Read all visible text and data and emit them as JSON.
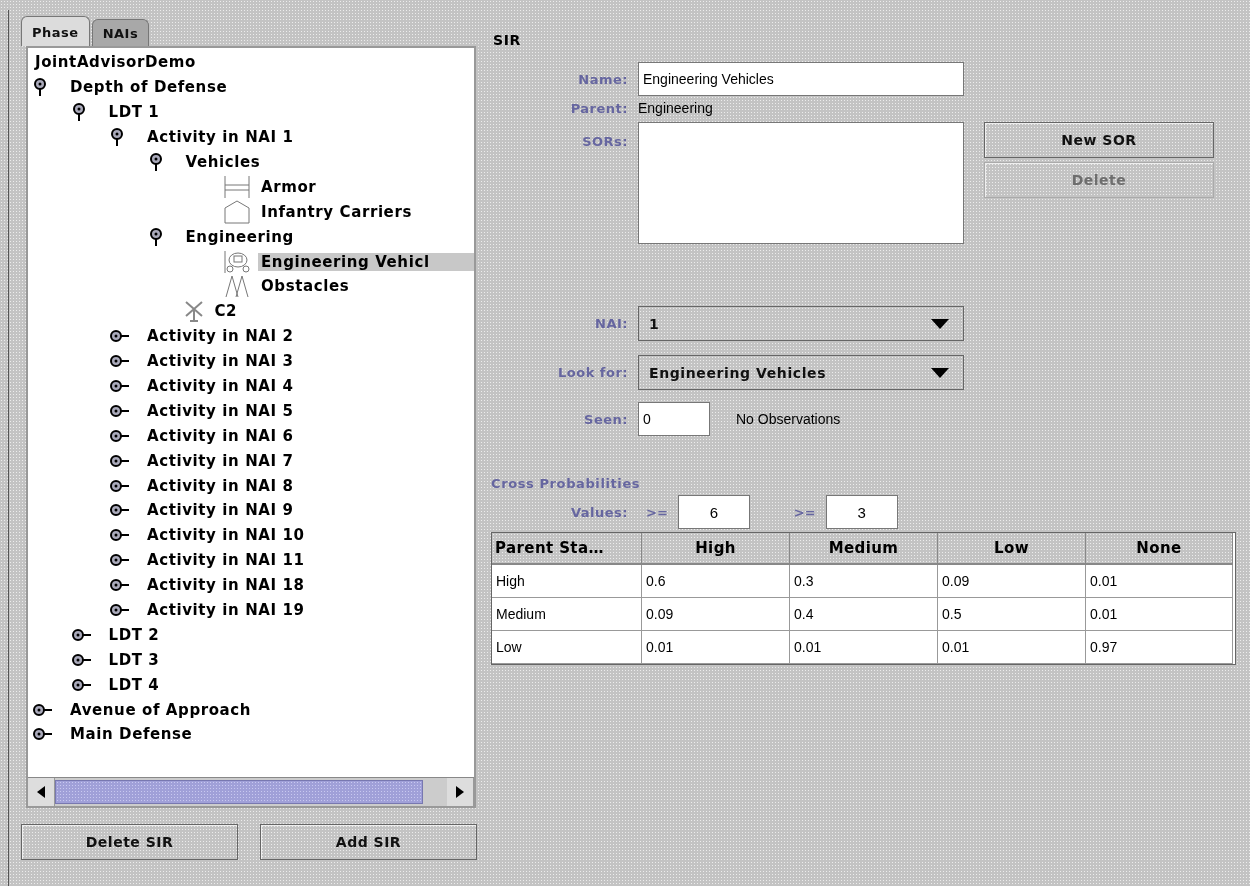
{
  "tabs": [
    {
      "label": "Phase",
      "selected": true
    },
    {
      "label": "NAIs",
      "selected": false
    }
  ],
  "tree": {
    "label": "JointAdvisorDemo",
    "kind": "root",
    "selected": false,
    "children": [
      {
        "label": "Depth of Defense",
        "kind": "group",
        "expanded": true,
        "selected": false,
        "children": [
          {
            "label": "LDT 1",
            "kind": "group",
            "expanded": true,
            "selected": false,
            "children": [
              {
                "label": "Activity in NAI 1",
                "kind": "group",
                "expanded": true,
                "selected": false,
                "children": [
                  {
                    "label": "Vehicles",
                    "kind": "group",
                    "expanded": true,
                    "selected": false,
                    "children": [
                      {
                        "label": "Armor",
                        "kind": "armor",
                        "selected": false
                      },
                      {
                        "label": "Infantry Carriers",
                        "kind": "infantry",
                        "selected": false
                      }
                    ]
                  },
                  {
                    "label": "Engineering",
                    "kind": "group",
                    "expanded": true,
                    "selected": false,
                    "children": [
                      {
                        "label": "Engineering Vehicl",
                        "kind": "engineer",
                        "selected": true
                      },
                      {
                        "label": "Obstacles",
                        "kind": "obstacle",
                        "selected": false
                      }
                    ]
                  },
                  {
                    "label": "C2",
                    "kind": "c2",
                    "selected": false
                  }
                ]
              },
              {
                "label": "Activity in NAI 2",
                "kind": "group",
                "expanded": false,
                "selected": false
              },
              {
                "label": "Activity in NAI 3",
                "kind": "group",
                "expanded": false,
                "selected": false
              },
              {
                "label": "Activity in NAI 4",
                "kind": "group",
                "expanded": false,
                "selected": false
              },
              {
                "label": "Activity in NAI 5",
                "kind": "group",
                "expanded": false,
                "selected": false
              },
              {
                "label": "Activity in NAI 6",
                "kind": "group",
                "expanded": false,
                "selected": false
              },
              {
                "label": "Activity in NAI 7",
                "kind": "group",
                "expanded": false,
                "selected": false
              },
              {
                "label": "Activity in NAI 8",
                "kind": "group",
                "expanded": false,
                "selected": false
              },
              {
                "label": "Activity in NAI 9",
                "kind": "group",
                "expanded": false,
                "selected": false
              },
              {
                "label": "Activity in NAI 10",
                "kind": "group",
                "expanded": false,
                "selected": false
              },
              {
                "label": "Activity in NAI 11",
                "kind": "group",
                "expanded": false,
                "selected": false
              },
              {
                "label": "Activity in NAI 18",
                "kind": "group",
                "expanded": false,
                "selected": false
              },
              {
                "label": "Activity in NAI 19",
                "kind": "group",
                "expanded": false,
                "selected": false
              }
            ]
          },
          {
            "label": "LDT 2",
            "kind": "group",
            "expanded": false,
            "selected": false
          },
          {
            "label": "LDT 3",
            "kind": "group",
            "expanded": false,
            "selected": false
          },
          {
            "label": "LDT 4",
            "kind": "group",
            "expanded": false,
            "selected": false
          }
        ]
      },
      {
        "label": "Avenue of Approach",
        "kind": "group",
        "expanded": false,
        "selected": false
      },
      {
        "label": "Main Defense",
        "kind": "group",
        "expanded": false,
        "selected": false
      }
    ]
  },
  "left_buttons": [
    {
      "label": "Delete SIR"
    },
    {
      "label": "Add SIR"
    }
  ],
  "sir": {
    "title": "SIR",
    "name": {
      "label": "Name:",
      "value": "Engineering Vehicles"
    },
    "parent": {
      "label": "Parent:",
      "value": "Engineering"
    },
    "sors": {
      "label": "SORs:"
    },
    "sor_buttons": [
      {
        "label": "New SOR",
        "disabled": false
      },
      {
        "label": "Delete",
        "disabled": true
      }
    ],
    "nai": {
      "label": "NAI:",
      "value": "1"
    },
    "look_for": {
      "label": "Look for:",
      "value": "Engineering Vehicles"
    },
    "seen": {
      "label": "Seen:",
      "value": "0",
      "note": "No Observations"
    },
    "cross": {
      "title": "Cross Probabilities",
      "values_label": "Values:",
      "thresholds": [
        {
          "op": ">=",
          "value": "6"
        },
        {
          "op": ">=",
          "value": "3"
        }
      ],
      "columns": [
        "Parent Sta…",
        "High",
        "Medium",
        "Low",
        "None"
      ],
      "rows": [
        [
          "High",
          "0.6",
          "0.3",
          "0.09",
          "0.01"
        ],
        [
          "Medium",
          "0.09",
          "0.4",
          "0.5",
          "0.01"
        ],
        [
          "Low",
          "0.01",
          "0.01",
          "0.01",
          "0.97"
        ]
      ]
    }
  }
}
